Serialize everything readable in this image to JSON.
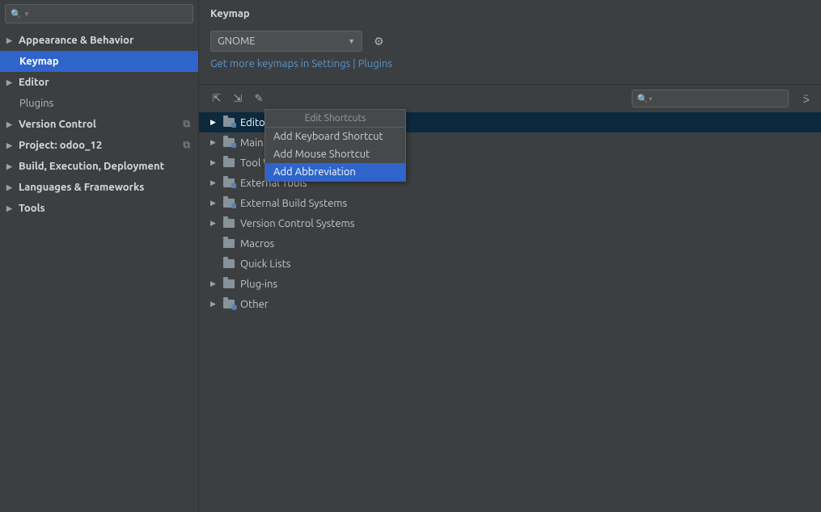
{
  "sidebar": {
    "search_placeholder": "",
    "items": [
      {
        "label": "Appearance & Behavior",
        "arrow": true,
        "bold": true
      },
      {
        "label": "Keymap",
        "arrow": false,
        "sub": true,
        "selected": true
      },
      {
        "label": "Editor",
        "arrow": true,
        "bold": true
      },
      {
        "label": "Plugins",
        "arrow": false,
        "subplain": true
      },
      {
        "label": "Version Control",
        "arrow": true,
        "bold": true,
        "badge": "⧉"
      },
      {
        "label": "Project: odoo_12",
        "arrow": true,
        "bold": true,
        "badge": "⧉"
      },
      {
        "label": "Build, Execution, Deployment",
        "arrow": true,
        "bold": true
      },
      {
        "label": "Languages & Frameworks",
        "arrow": true,
        "bold": true
      },
      {
        "label": "Tools",
        "arrow": true,
        "bold": true
      }
    ]
  },
  "main": {
    "title": "Keymap",
    "scheme_selected": "GNOME",
    "link_text": "Get more keymaps in Settings | Plugins",
    "tree": [
      {
        "label": "Editor Actions",
        "arrow": true,
        "folder": "special",
        "selected": true
      },
      {
        "label": "Main menu",
        "arrow": true,
        "folder": "special"
      },
      {
        "label": "Tool Windows",
        "arrow": true,
        "folder": "plain"
      },
      {
        "label": "External Tools",
        "arrow": true,
        "folder": "special"
      },
      {
        "label": "External Build Systems",
        "arrow": true,
        "folder": "special"
      },
      {
        "label": "Version Control Systems",
        "arrow": true,
        "folder": "plain"
      },
      {
        "label": "Macros",
        "arrow": false,
        "folder": "plain"
      },
      {
        "label": "Quick Lists",
        "arrow": false,
        "folder": "plain"
      },
      {
        "label": "Plug-ins",
        "arrow": true,
        "folder": "plain"
      },
      {
        "label": "Other",
        "arrow": true,
        "folder": "star"
      }
    ]
  },
  "context_menu": {
    "title": "Edit Shortcuts",
    "items": [
      {
        "label": "Add Keyboard Shortcut"
      },
      {
        "label": "Add Mouse Shortcut"
      },
      {
        "label": "Add Abbreviation",
        "highlight": true
      }
    ]
  }
}
